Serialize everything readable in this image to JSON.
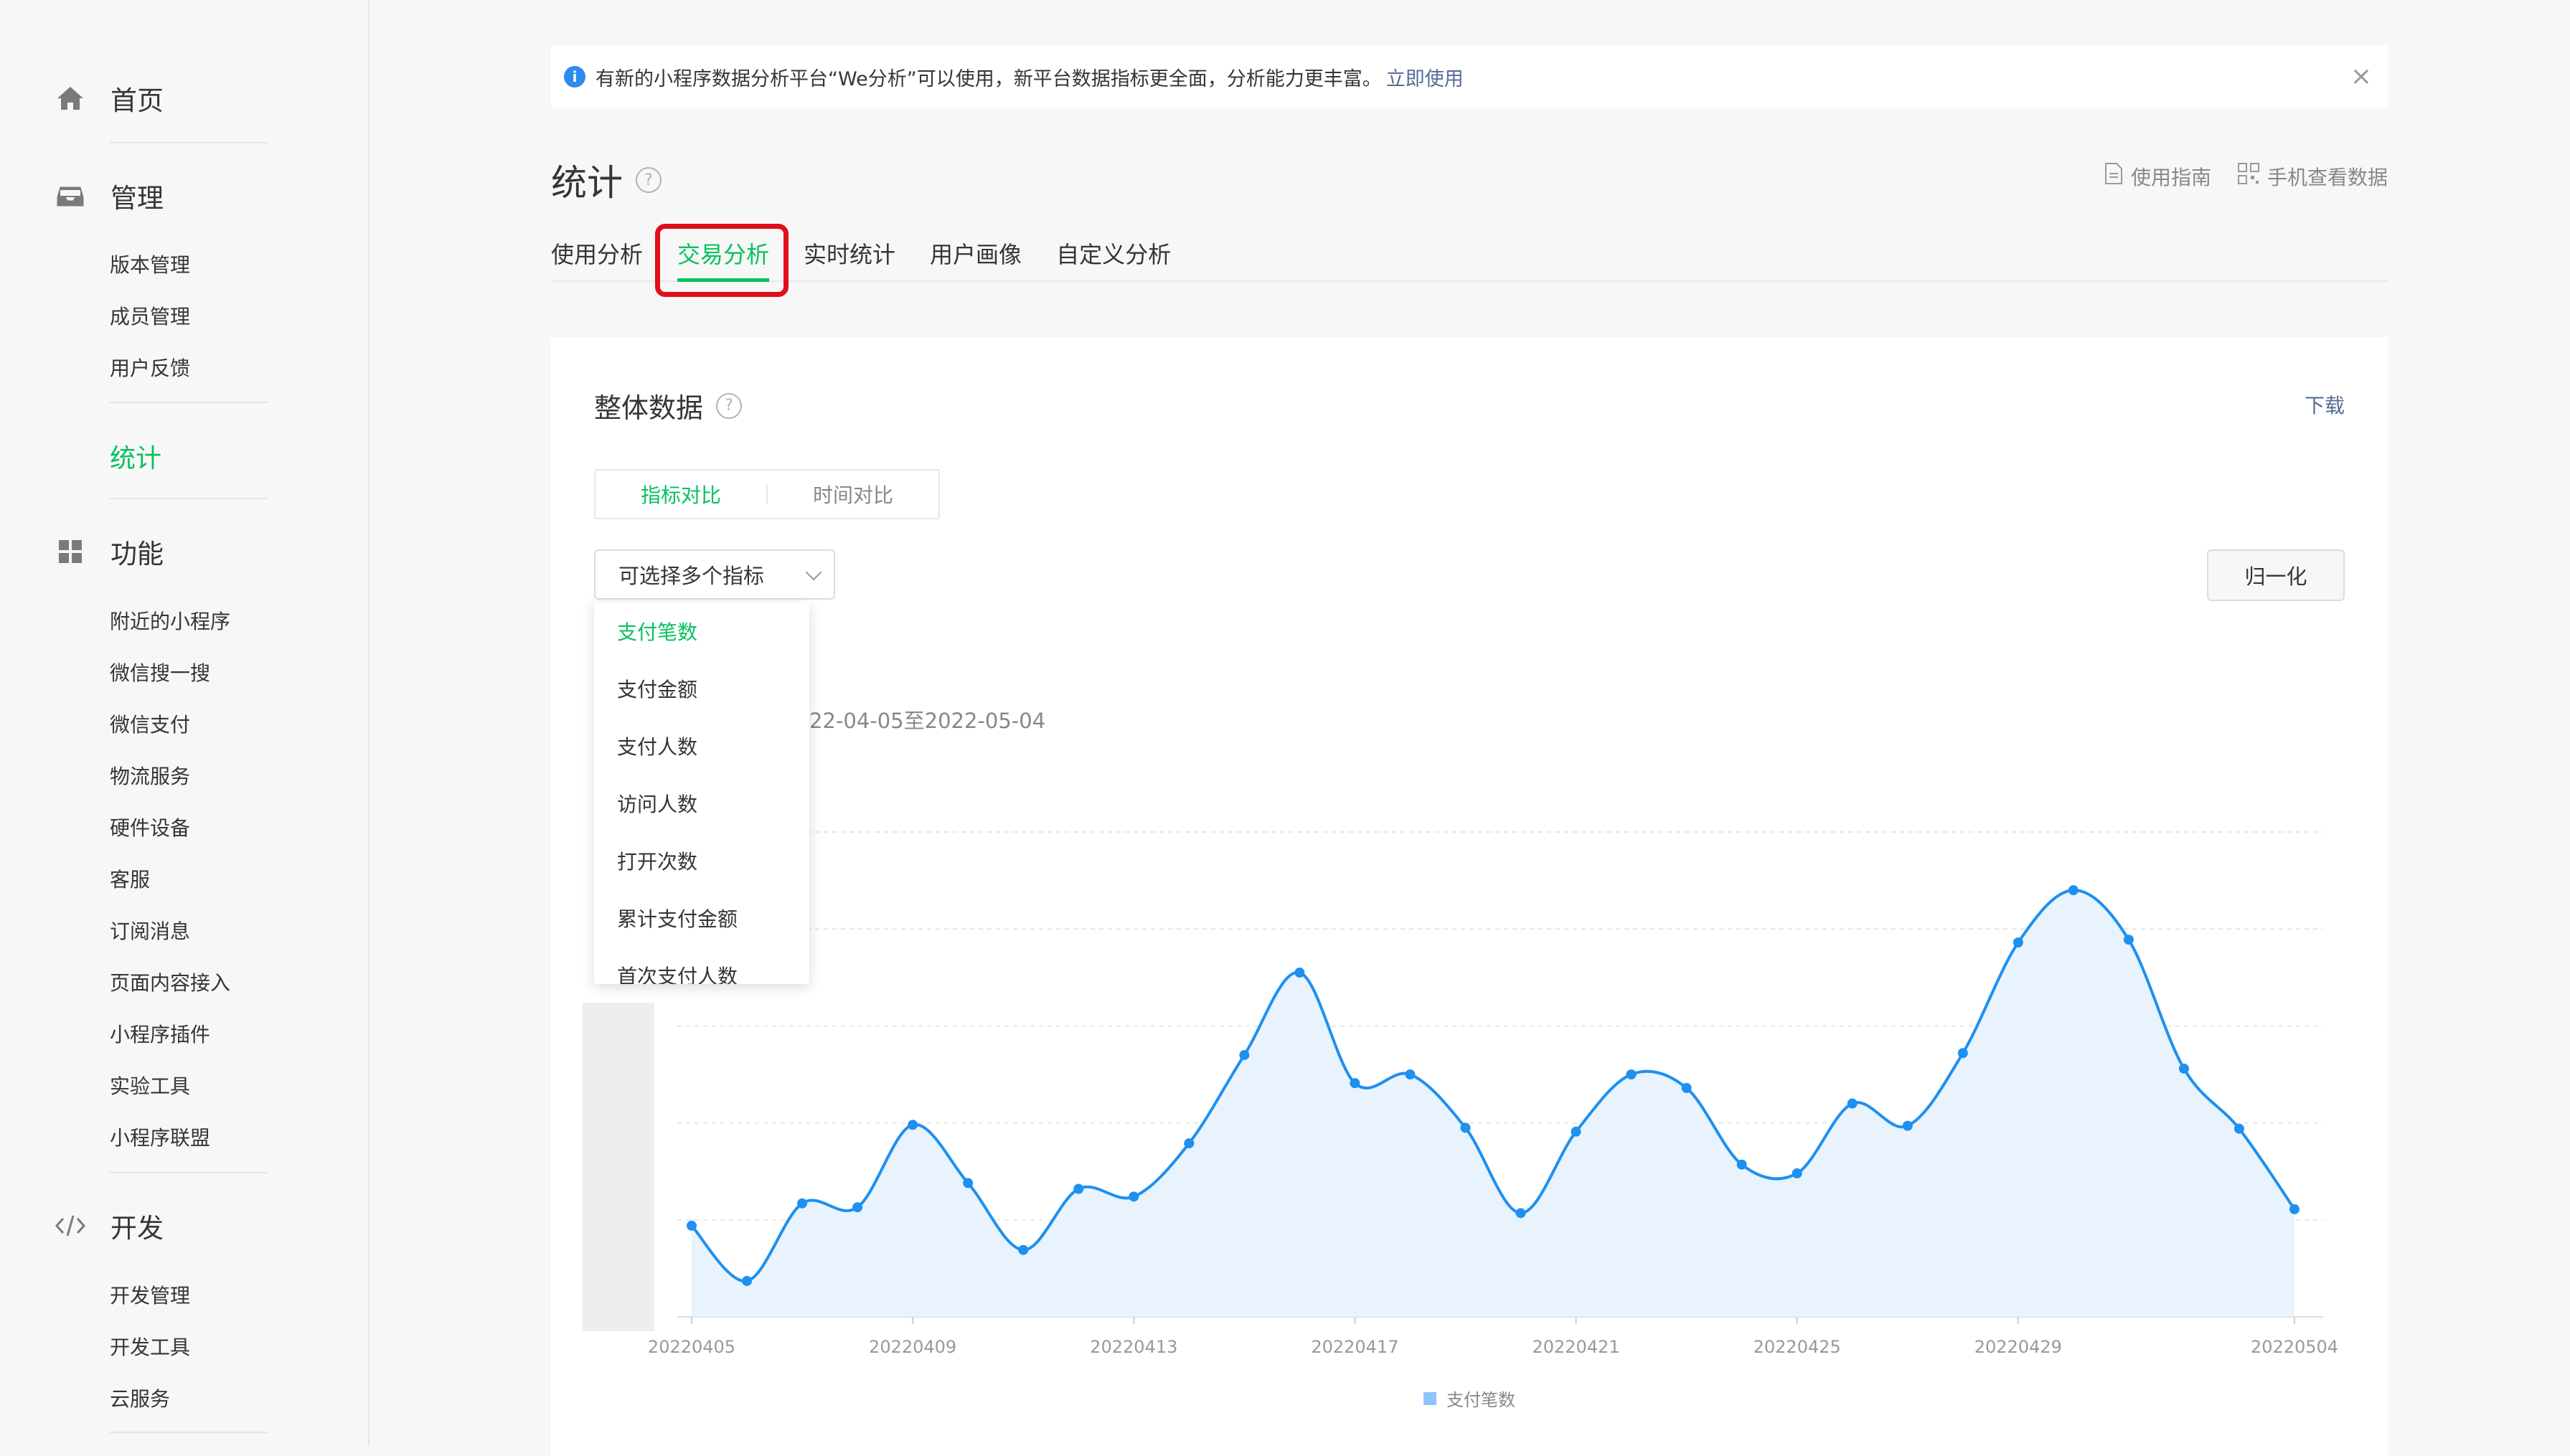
{
  "sidebar": {
    "home": "首页",
    "manage": "管理",
    "manage_items": [
      "版本管理",
      "成员管理",
      "用户反馈"
    ],
    "stats": "统计",
    "features": "功能",
    "feature_items": [
      "附近的小程序",
      "微信搜一搜",
      "微信支付",
      "物流服务",
      "硬件设备",
      "客服",
      "订阅消息",
      "页面内容接入",
      "小程序插件",
      "实验工具",
      "小程序联盟"
    ],
    "dev": "开发",
    "dev_items": [
      "开发管理",
      "开发工具",
      "云服务"
    ]
  },
  "notice": {
    "text": "有新的小程序数据分析平台“We分析”可以使用，新平台数据指标更全面，分析能力更丰富。",
    "link": "立即使用",
    "close": "×"
  },
  "header": {
    "title": "统计",
    "help": "?",
    "guide": "使用指南",
    "mobile": "手机查看数据"
  },
  "tabs": [
    "使用分析",
    "交易分析",
    "实时统计",
    "用户画像",
    "自定义分析"
  ],
  "card": {
    "title": "整体数据",
    "download": "下载",
    "segments": [
      "指标对比",
      "时间对比"
    ],
    "select_placeholder": "可选择多个指标",
    "normalize": "归一化",
    "date_range": "22-04-05至2022-05-04",
    "dropdown": [
      "支付笔数",
      "支付金额",
      "支付人数",
      "访问人数",
      "打开次数",
      "累计支付金额",
      "首次支付人数"
    ]
  },
  "chart_data": {
    "type": "area",
    "x": [
      "20220405",
      "20220406",
      "20220407",
      "20220408",
      "20220409",
      "20220410",
      "20220411",
      "20220412",
      "20220413",
      "20220414",
      "20220415",
      "20220416",
      "20220417",
      "20220418",
      "20220419",
      "20220420",
      "20220421",
      "20220422",
      "20220423",
      "20220424",
      "20220425",
      "20220426",
      "20220427",
      "20220428",
      "20220429",
      "20220430",
      "20220501",
      "20220502",
      "20220503",
      "20220504"
    ],
    "xticks": [
      "20220405",
      "20220409",
      "20220413",
      "20220417",
      "20220421",
      "20220425",
      "20220429",
      "20220504"
    ],
    "series": [
      {
        "name": "支付笔数",
        "values": [
          9.4,
          3.7,
          11.7,
          11.3,
          19.8,
          13.8,
          6.9,
          13.2,
          12.4,
          17.9,
          27.0,
          35.5,
          24.1,
          25.0,
          19.5,
          10.7,
          19.1,
          25.0,
          23.6,
          15.7,
          14.8,
          22.0,
          19.7,
          27.2,
          38.6,
          44.0,
          38.9,
          25.6,
          19.4,
          11.1
        ]
      }
    ],
    "ylim": [
      0,
      50
    ],
    "grid": true,
    "legend": "bottom",
    "colors": {
      "line": "#1e90f0",
      "fill": "#e8f3fd"
    }
  }
}
